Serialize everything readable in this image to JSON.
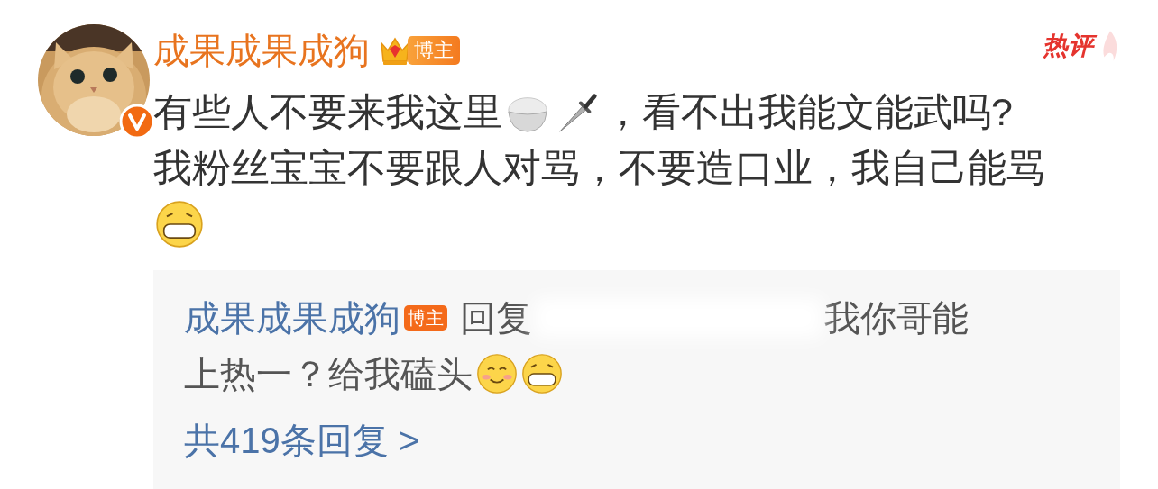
{
  "comment": {
    "author": "成果成果成狗",
    "author_badge": "博主",
    "verified": true,
    "hot_label": "热评",
    "avatar": {
      "kind": "picture"
    },
    "lines": [
      [
        {
          "kind": "text",
          "text": "有些人不要来我这里"
        },
        {
          "kind": "rice_bowl"
        },
        {
          "kind": "dagger"
        },
        {
          "kind": "text",
          "text": "，看不出我能文能武吗?"
        }
      ],
      [
        {
          "kind": "text",
          "text": "我粉丝宝宝不要跟人对骂，不要造口业，我自己能骂"
        }
      ],
      [
        {
          "kind": "grin"
        }
      ]
    ],
    "reply": {
      "author": "成果成果成狗",
      "author_badge": "博主",
      "lines": [
        [
          {
            "kind": "text",
            "text": "回复"
          },
          {
            "kind": "blur"
          },
          {
            "kind": "text",
            "text": "我你哥能"
          }
        ],
        [
          {
            "kind": "text",
            "text": "上热一？给我磕头"
          },
          {
            "kind": "smile"
          },
          {
            "kind": "grin"
          }
        ]
      ],
      "more_link": "共419条回复 >"
    }
  }
}
